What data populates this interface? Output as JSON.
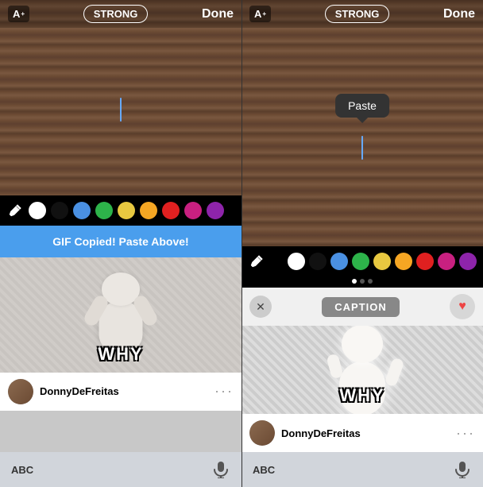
{
  "left": {
    "editorBar": {
      "textSizeLabel": "A",
      "strongLabel": "STRONG",
      "doneLabel": "Done"
    },
    "colors": [
      {
        "name": "pencil",
        "type": "icon"
      },
      {
        "color": "#ffffff",
        "name": "white"
      },
      {
        "color": "#111111",
        "name": "black"
      },
      {
        "color": "#4a90e2",
        "name": "blue"
      },
      {
        "color": "#2db34a",
        "name": "green"
      },
      {
        "color": "#e8c840",
        "name": "yellow"
      },
      {
        "color": "#f5a623",
        "name": "orange"
      },
      {
        "color": "#e02020",
        "name": "red"
      },
      {
        "color": "#c82080",
        "name": "pink"
      },
      {
        "color": "#8e24aa",
        "name": "purple"
      }
    ],
    "gifCopiedBar": "GIF Copied! Paste Above!",
    "gif": {
      "whyText": "WHY",
      "username": "DonnyDeFreitas"
    },
    "keyboardBar": {
      "abcLabel": "ABC"
    }
  },
  "right": {
    "editorBar": {
      "textSizeLabel": "A",
      "strongLabel": "STRONG",
      "doneLabel": "Done"
    },
    "pastePopup": "Paste",
    "colors": [
      {
        "name": "pencil",
        "type": "icon"
      },
      {
        "color": "#ffffff",
        "name": "white"
      },
      {
        "color": "#111111",
        "name": "black"
      },
      {
        "color": "#4a90e2",
        "name": "blue"
      },
      {
        "color": "#2db34a",
        "name": "green"
      },
      {
        "color": "#e8c840",
        "name": "yellow"
      },
      {
        "color": "#f5a623",
        "name": "orange"
      },
      {
        "color": "#e02020",
        "name": "red"
      },
      {
        "color": "#c82080",
        "name": "pink"
      },
      {
        "color": "#8e24aa",
        "name": "purple"
      }
    ],
    "captionRow": {
      "captionLabel": "CAPTION"
    },
    "gif": {
      "whyText": "WHY",
      "username": "DonnyDeFreitas"
    },
    "keyboardBar": {
      "abcLabel": "ABC"
    }
  }
}
